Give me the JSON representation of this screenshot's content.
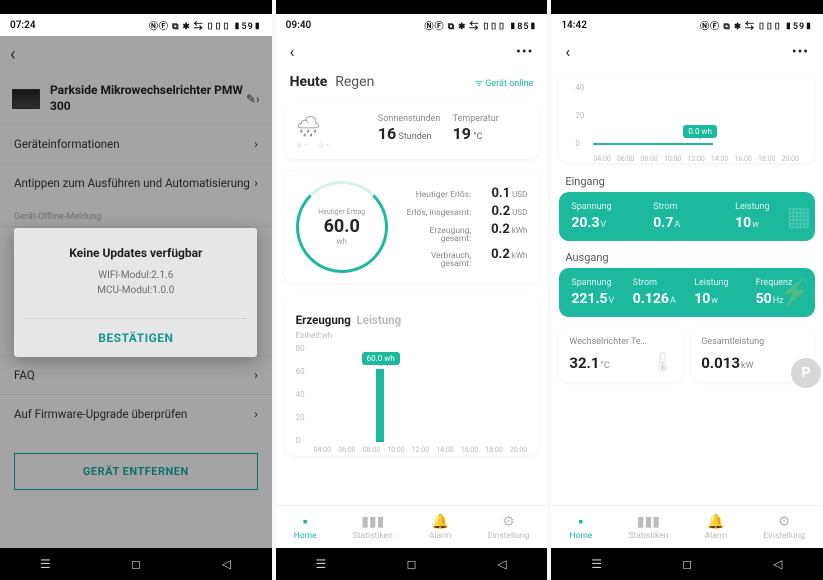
{
  "phone1": {
    "time": "07:24",
    "status_icons_left": "⬒ N ▶ ⋯",
    "status_icons_right": "ⓃⒻ ⧉ ✱ ⇆ ▯▯▯ ▮59▮",
    "device_name": "Parkside Mikrowechselrichter PMW 300",
    "menu": {
      "info": "Geräteinformationen",
      "automation": "Antippen zum Ausführen und Automatisierung"
    },
    "section_header": "Gerät-Offline-Meldung",
    "faq": "FAQ",
    "firmware": "Auf Firmware-Upgrade überprüfen",
    "remove": "GERÄT ENTFERNEN",
    "modal": {
      "title": "Keine Updates verfügbar",
      "wifi": "WIFI-Modul:2.1.6",
      "mcu": "MCU-Modul:1.0.0",
      "confirm": "BESTÄTIGEN"
    }
  },
  "phone2": {
    "time": "09:40",
    "status_icons_left": "b ✂ ▶ ⬛ ⋯",
    "status_icons_right": "ⓃⒻ ⧉ ✱ ⇆ ▯▯▯ ▮85▮",
    "today_label": "Heute",
    "weather_label": "Regen",
    "online": "Gerät online",
    "sunhours_label": "Sonnenstunden",
    "sunhours_value": "16",
    "sunhours_unit": "Stunden",
    "temp_label": "Temperatur",
    "temp_value": "19",
    "temp_unit": "°C",
    "sunrise_icon": "☼ -",
    "sunset_icon": "☼ -",
    "ring_label": "Heutiger Ertrag",
    "ring_value": "60.0",
    "ring_unit": "wh",
    "kv": [
      {
        "k": "Heutiger Erlös:",
        "v": "0.1",
        "u": "USD"
      },
      {
        "k": "Erlös, insgesamt:",
        "v": "0.2",
        "u": "USD"
      },
      {
        "k": "Erzeugung, gesamt:",
        "v": "0.2",
        "u": "kWh"
      },
      {
        "k": "Verbrauch, gesamt:",
        "v": "0.2",
        "u": "kWh"
      }
    ],
    "tab_active": "Erzeugung",
    "tab_inactive": "Leistung",
    "chart_unit": "Einheit:wh",
    "chart_tip": "60.0 wh",
    "chart_data": {
      "type": "bar",
      "categories": [
        "04:00",
        "06:00",
        "08:00",
        "10:00",
        "12:00",
        "14:00",
        "16:00",
        "18:00",
        "20:00"
      ],
      "values": [
        0,
        0,
        0,
        60,
        null,
        null,
        null,
        null,
        null
      ],
      "ylabel": "",
      "ylim": [
        0,
        80
      ],
      "yticks": [
        0,
        20,
        40,
        60,
        80
      ],
      "unit": "wh"
    },
    "tabbar": {
      "home": "Home",
      "stats": "Statistiken",
      "alarm": "Alarm",
      "settings": "Einstellung"
    }
  },
  "phone3": {
    "time": "14:42",
    "status_icons_left": "⬒ ⬛ b ⬛ ⬛ ⋯",
    "status_icons_right": "ⓃⒻ ⧉ ✱ ⇆ ▯▯▯ ▮59▮",
    "line_tip": "0.0 wh",
    "chart_data": {
      "type": "line",
      "x": [
        "04:00",
        "06:00",
        "08:00",
        "10:00",
        "12:00",
        "14:00",
        "16:00",
        "18:00",
        "20:00"
      ],
      "yticks": [
        0,
        20,
        40
      ],
      "ylim": [
        0,
        40
      ],
      "series": [
        {
          "name": "wh",
          "values": [
            0,
            0,
            0,
            0,
            0,
            0,
            null,
            null,
            null
          ]
        }
      ]
    },
    "input_label": "Eingang",
    "output_label": "Ausgang",
    "input": {
      "volt_label": "Spannung",
      "volt_v": "20.3",
      "volt_u": "V",
      "amp_label": "Strom",
      "amp_v": "0.7",
      "amp_u": "A",
      "pow_label": "Leistung",
      "pow_v": "10",
      "pow_u": "w"
    },
    "output": {
      "volt_label": "Spannung",
      "volt_v": "221.5",
      "volt_u": "V",
      "amp_label": "Strom",
      "amp_v": "0.126",
      "amp_u": "A",
      "pow_label": "Leistung",
      "pow_v": "10",
      "pow_u": "w",
      "freq_label": "Frequenz",
      "freq_v": "50",
      "freq_u": "Hz"
    },
    "wc1_label": "Wechselrichter Te…",
    "wc1_v": "32.1",
    "wc1_u": "°C",
    "wc2_label": "Gesamtleistung",
    "wc2_v": "0.013",
    "wc2_u": "kW",
    "tabbar": {
      "home": "Home",
      "stats": "Statistiken",
      "alarm": "Alarm",
      "settings": "Einstellung"
    }
  }
}
